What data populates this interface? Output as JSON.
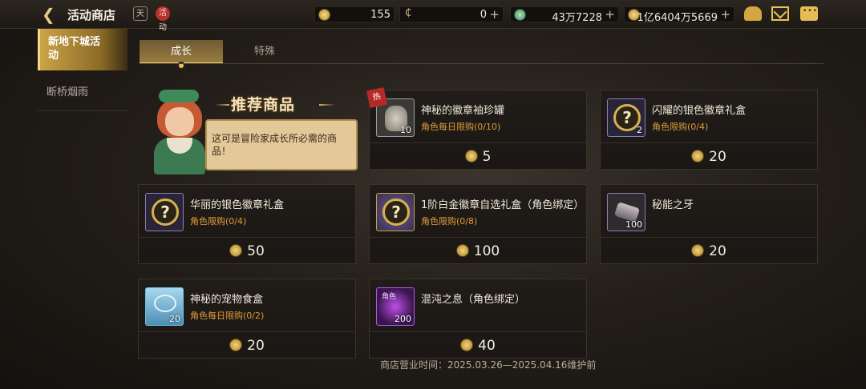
{
  "header": {
    "back_icon": "back-arrow-icon",
    "title": "活动商店",
    "calendar_icon_text": "天",
    "tag_icon_text": "活动",
    "currencies": [
      {
        "icon": "token-coin-icon",
        "value": "155"
      },
      {
        "icon": "c-coin-icon",
        "value": "0"
      },
      {
        "icon": "green-gem-icon",
        "value": "43万7228"
      },
      {
        "icon": "gold-coin-icon",
        "value": "1亿6404万5669"
      }
    ],
    "plus": "+"
  },
  "sidebar": {
    "items": [
      {
        "label": "新地下城活动",
        "active": true
      },
      {
        "label": "断桥烟雨",
        "active": false
      }
    ]
  },
  "tabs": [
    {
      "label": "成长",
      "active": true
    },
    {
      "label": "特殊",
      "active": false
    }
  ],
  "featured": {
    "title": "推荐商品",
    "speech": "这可是冒险家成长所必需的商品！"
  },
  "items": [
    {
      "name": "神秘的徽章袖珍罐",
      "limit": "角色每日限购(0/10)",
      "count": "10",
      "price": "5",
      "icon": "jar-icon",
      "hot": "热"
    },
    {
      "name": "闪耀的银色徽章礼盒",
      "limit": "角色限购(0/4)",
      "count": "2",
      "price": "20",
      "icon": "question-box-icon"
    },
    {
      "name": "华丽的银色徽章礼盒",
      "limit": "角色限购(0/4)",
      "count": "",
      "price": "50",
      "icon": "question-box-icon"
    },
    {
      "name": "1阶白金徽章自选礼盒（角色绑定）",
      "limit": "角色限购(0/8)",
      "count": "",
      "price": "100",
      "icon": "gold-question-box-icon"
    },
    {
      "name": "秘能之牙",
      "limit": "",
      "count": "100",
      "price": "20",
      "icon": "fang-icon"
    },
    {
      "name": "神秘的宠物食盒",
      "limit": "角色每日限购(0/2)",
      "count": "20",
      "price": "20",
      "icon": "pet-food-box-icon"
    },
    {
      "name": "混沌之息（角色绑定）",
      "limit": "",
      "count": "200",
      "price": "40",
      "icon": "chaos-breath-icon",
      "icon_text": "角色"
    }
  ],
  "footer": "商店营业时间：2025.03.26—2025.04.16维护前"
}
